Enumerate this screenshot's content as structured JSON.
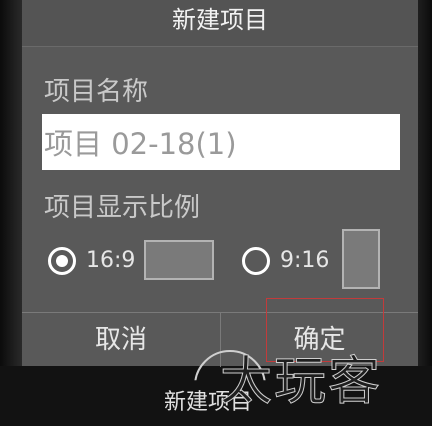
{
  "dialog": {
    "title": "新建项目",
    "name_label": "项目名称",
    "name_value": "项目 02-18(1)",
    "ratio_label": "项目显示比例",
    "ratio_options": [
      {
        "label": "16:9",
        "selected": true
      },
      {
        "label": "9:16",
        "selected": false
      }
    ],
    "cancel_label": "取消",
    "confirm_label": "确定"
  },
  "background": {
    "bottom_label": "新建项目"
  },
  "watermark": "太玩客",
  "colors": {
    "dialog_bg": "#595959",
    "highlight": "#c23b3b"
  }
}
